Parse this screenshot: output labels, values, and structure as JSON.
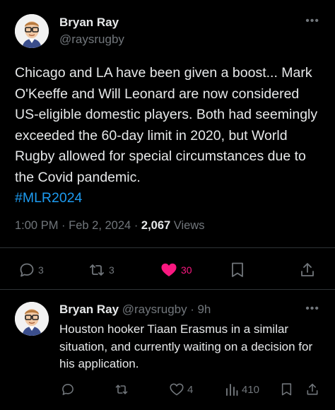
{
  "main_tweet": {
    "author_name": "Bryan Ray",
    "author_handle": "@raysrugby",
    "more_label": "•••",
    "text": "Chicago and LA have been given a boost... Mark O'Keeffe and Will Leonard are now considered US-eligible domestic players. Both had seemingly exceeded the 60-day limit in 2020, but World Rugby allowed for special circumstances due to the Covid pandemic.",
    "hashtag": "#MLR2024",
    "time": "1:00 PM",
    "date": "Feb 2, 2024",
    "separator": "·",
    "views_count": "2,067",
    "views_label": "Views",
    "replies": "3",
    "reposts": "3",
    "likes": "30"
  },
  "reply_tweet": {
    "author_name": "Bryan Ray",
    "author_handle": "@raysrugby",
    "age": "9h",
    "separator": "·",
    "more_label": "•••",
    "text": "Houston hooker Tiaan Erasmus in a similar situation, and currently waiting on a decision for his application.",
    "likes": "4",
    "views": "410"
  },
  "colors": {
    "background": "#000000",
    "text": "#e7e9ea",
    "secondary": "#71767b",
    "link": "#1d9bf0",
    "like": "#f91880",
    "divider": "#2f3336"
  },
  "icons": [
    "reply-icon",
    "repost-icon",
    "heart-filled-icon",
    "heart-outline-icon",
    "bookmark-icon",
    "share-icon",
    "views-chart-icon",
    "more-icon"
  ]
}
